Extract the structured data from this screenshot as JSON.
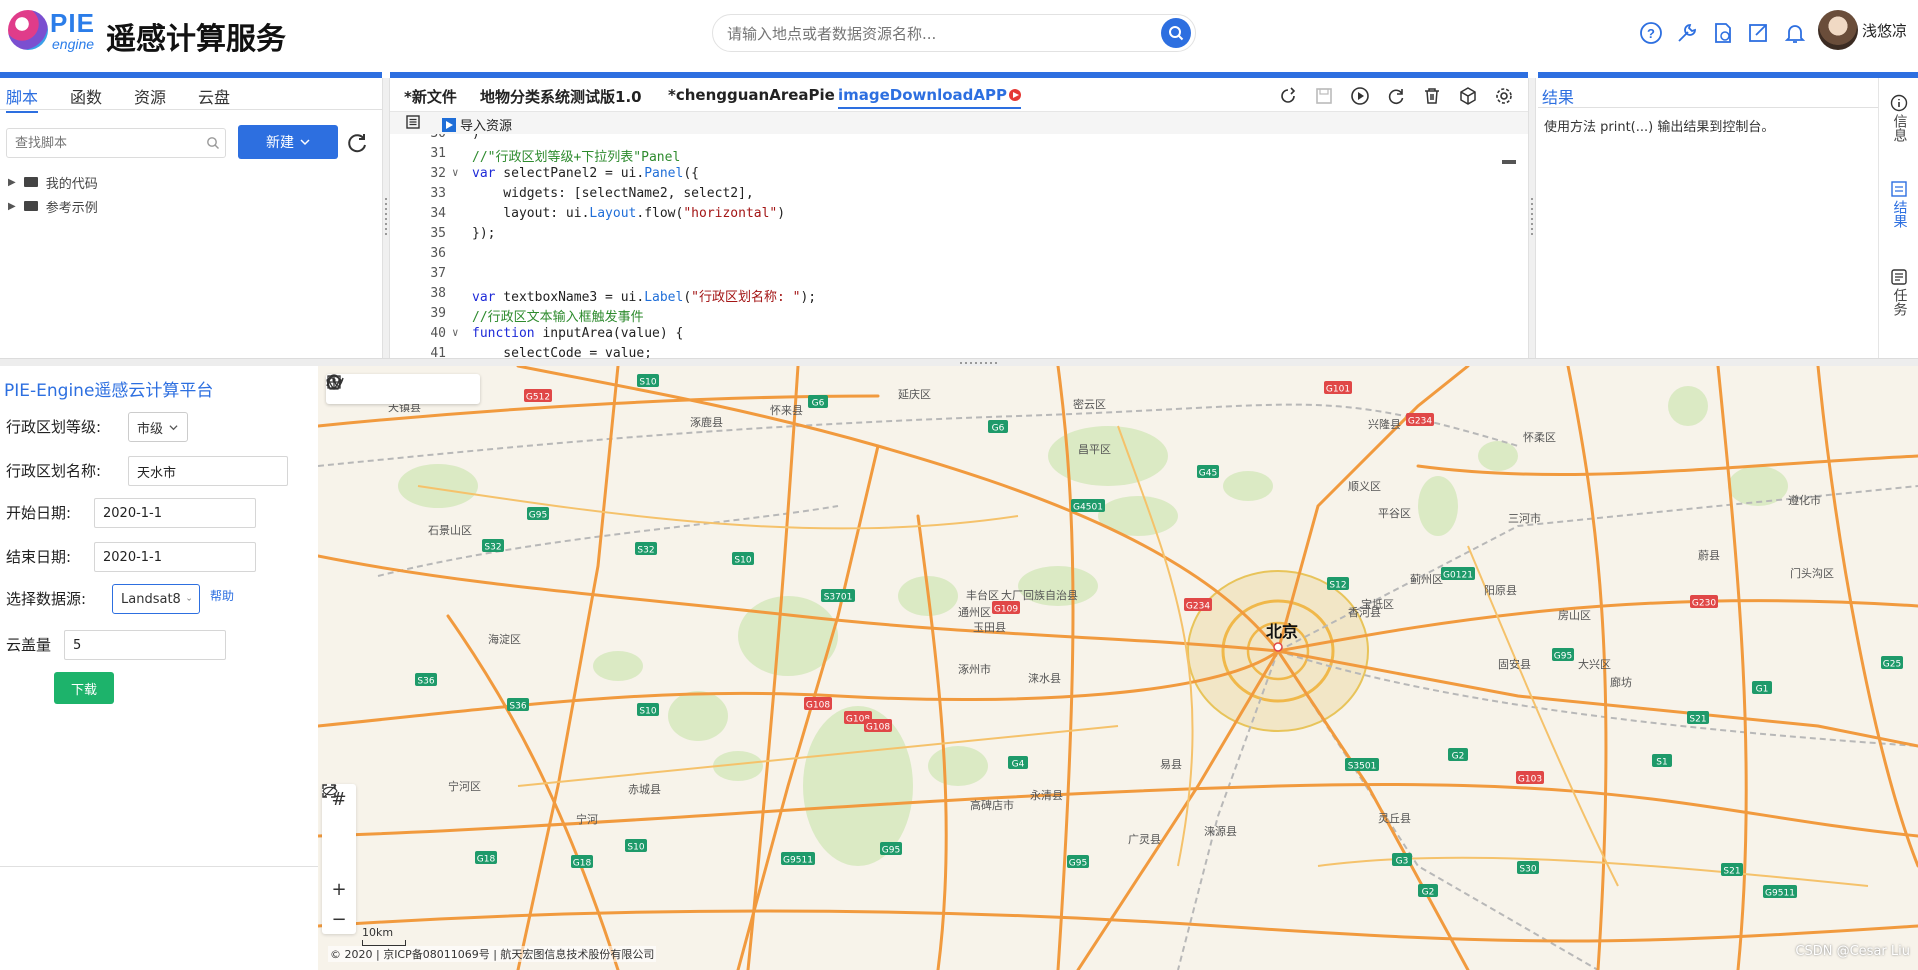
{
  "header": {
    "logo_pie": "PIE",
    "logo_engine": "engine",
    "title": "遥感计算服务",
    "search_placeholder": "请输入地点或者数据资源名称...",
    "username": "浅悠凉",
    "icons": [
      "help-icon",
      "tools-icon",
      "document-clock-icon",
      "edit-icon",
      "bell-icon"
    ]
  },
  "left_panel": {
    "tabs": [
      "脚本",
      "函数",
      "资源",
      "云盘"
    ],
    "active_tab": "脚本",
    "find_placeholder": "查找脚本",
    "new_button": "新建",
    "tree": [
      "我的代码",
      "参考示例"
    ]
  },
  "editor": {
    "file_tabs": [
      "*新文件",
      "地物分类系统测试版1.0",
      "*chengguanAreaPie",
      "imageDownloadAPP"
    ],
    "active_tab": "imageDownloadAPP",
    "import_label": "导入资源",
    "toolbar_icons": [
      "share-icon",
      "save-icon",
      "run-icon",
      "reset-icon",
      "delete-icon",
      "package-icon",
      "settings-icon"
    ]
  },
  "code": [
    {
      "n": "30",
      "fold": "",
      "text": ")"
    },
    {
      "n": "31",
      "fold": "",
      "text": "//\"行政区划等级+下拉列表\"Panel"
    },
    {
      "n": "32",
      "fold": "∨",
      "text": "var selectPanel2 = ui.Panel({"
    },
    {
      "n": "33",
      "fold": "",
      "text": "    widgets: [selectName2, select2],"
    },
    {
      "n": "34",
      "fold": "",
      "text": "    layout: ui.Layout.flow(\"horizontal\")"
    },
    {
      "n": "35",
      "fold": "",
      "text": "});"
    },
    {
      "n": "36",
      "fold": "",
      "text": ""
    },
    {
      "n": "37",
      "fold": "",
      "text": ""
    },
    {
      "n": "38",
      "fold": "",
      "text": "var textboxName3 = ui.Label(\"行政区划名称: \");"
    },
    {
      "n": "39",
      "fold": "",
      "text": "//行政区文本输入框触发事件"
    },
    {
      "n": "40",
      "fold": "∨",
      "text": "function inputArea(value) {"
    },
    {
      "n": "41",
      "fold": "",
      "text": "    selectCode = value;"
    }
  ],
  "result": {
    "tab": "结果",
    "message": "使用方法 print(...) 输出结果到控制台。",
    "rail": [
      {
        "label": "信息",
        "icon": "info-icon"
      },
      {
        "label": "结果",
        "icon": "results-icon"
      },
      {
        "label": "任务",
        "icon": "tasks-icon"
      }
    ]
  },
  "app": {
    "title": "PIE-Engine遥感云计算平台",
    "level_label": "行政区划等级:",
    "level_value": "市级",
    "name_label": "行政区划名称:",
    "name_value": "天水市",
    "start_label": "开始日期:",
    "start_value": "2020-1-1",
    "end_label": "结束日期:",
    "end_value": "2020-1-1",
    "source_label": "选择数据源:",
    "source_value": "Landsat8",
    "help": "帮助",
    "cloud_label": "云盖量",
    "cloud_value": "5",
    "download": "下载"
  },
  "map": {
    "city_label": "北京",
    "scale": "10km",
    "copyright": "© 2020 | 京ICP备08011069号 | 航天宏图信息技术股份有限公司",
    "watermark": "CSDN @Cesar Liu",
    "labels": [
      "天镇县",
      "涿鹿县",
      "怀来县",
      "延庆区",
      "密云区",
      "兴隆县",
      "怀柔区",
      "昌平区",
      "顺义区",
      "平谷区",
      "蓟州区",
      "三河市",
      "遵化市",
      "阳原县",
      "蔚县",
      "门头沟区",
      "石景山区",
      "海淀区",
      "丰台区",
      "通州区",
      "大厂回族自治县",
      "玉田县",
      "宝坻区",
      "香河县",
      "房山区",
      "大兴区",
      "廊坊",
      "固安县",
      "涿州市",
      "涞水县",
      "易县",
      "永清县",
      "高碑店市",
      "广灵县",
      "灵丘县",
      "涞源县",
      "宁河区",
      "赤城县",
      "宁河"
    ],
    "roads": [
      "G512",
      "G512",
      "S10",
      "G6",
      "G6",
      "G101",
      "G234",
      "G45",
      "G4501",
      "G95",
      "S32",
      "S32",
      "S10",
      "S3701",
      "G109",
      "G234",
      "S12",
      "G0121",
      "G95",
      "G230",
      "G25",
      "S36",
      "S36",
      "S10",
      "G108",
      "G108",
      "G108",
      "G4",
      "S3501",
      "G2",
      "G103",
      "S21",
      "G1",
      "S1",
      "G18",
      "G18",
      "S10",
      "G9511",
      "G95",
      "G95",
      "G3",
      "G2",
      "S30",
      "S21",
      "G9511"
    ]
  }
}
